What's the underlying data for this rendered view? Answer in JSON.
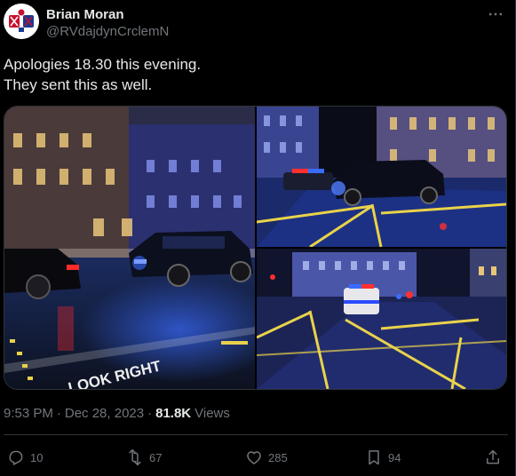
{
  "author": {
    "display_name": "Brian Moran",
    "handle": "@RVdajdynCrclemN"
  },
  "tweet": {
    "line1": "Apologies 18.30 this evening.",
    "line2": "They sent this as well."
  },
  "media": {
    "photo1_road_text": "LOOK RIGHT"
  },
  "meta": {
    "time": "9:53 PM",
    "separator": "·",
    "date": "Dec 28, 2023",
    "views_count": "81.8K",
    "views_label": "Views"
  },
  "actions": {
    "replies": "10",
    "reposts": "67",
    "likes": "285",
    "bookmarks": "94"
  },
  "icons": {
    "more": "more-horizontal-icon",
    "reply": "reply-icon",
    "repost": "repost-icon",
    "like": "heart-icon",
    "bookmark": "bookmark-icon",
    "share": "share-icon"
  },
  "colors": {
    "background": "#000000",
    "text_primary": "#e7e9ea",
    "text_secondary": "#71767b",
    "border": "#2f3336",
    "police_blue": "#1e5bff"
  }
}
